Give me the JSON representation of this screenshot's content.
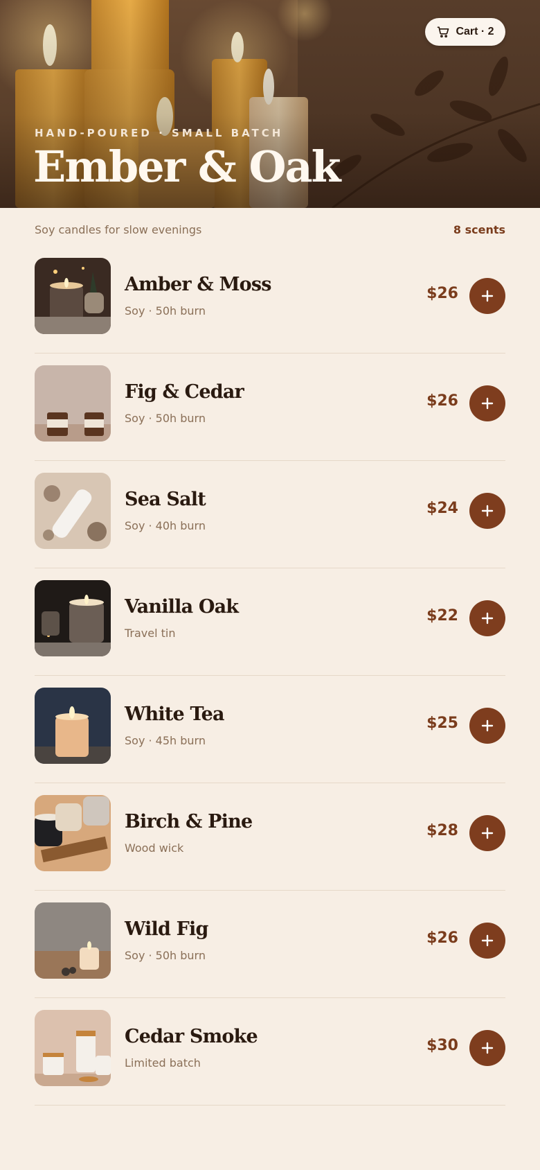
{
  "hero": {
    "eyebrow": "HAND-POURED · SMALL BATCH",
    "brand": "Ember & Oak"
  },
  "cart": {
    "label": "Cart · 2",
    "icon": "cart-icon"
  },
  "subhead": "Soy candles for slow evenings",
  "count": "8 scents",
  "colors": {
    "background": "#f7eee4",
    "accent": "#7e3d1e",
    "muted": "#8a6f57"
  },
  "products": [
    {
      "name": "Amber & Moss",
      "meta": "Soy · 50h burn",
      "price": "$26"
    },
    {
      "name": "Fig & Cedar",
      "meta": "Soy · 50h burn",
      "price": "$26"
    },
    {
      "name": "Sea Salt",
      "meta": "Soy · 40h burn",
      "price": "$24"
    },
    {
      "name": "Vanilla Oak",
      "meta": "Travel tin",
      "price": "$22"
    },
    {
      "name": "White Tea",
      "meta": "Soy · 45h burn",
      "price": "$25"
    },
    {
      "name": "Birch & Pine",
      "meta": "Wood wick",
      "price": "$28"
    },
    {
      "name": "Wild Fig",
      "meta": "Soy · 50h burn",
      "price": "$26"
    },
    {
      "name": "Cedar Smoke",
      "meta": "Limited batch",
      "price": "$30"
    }
  ]
}
